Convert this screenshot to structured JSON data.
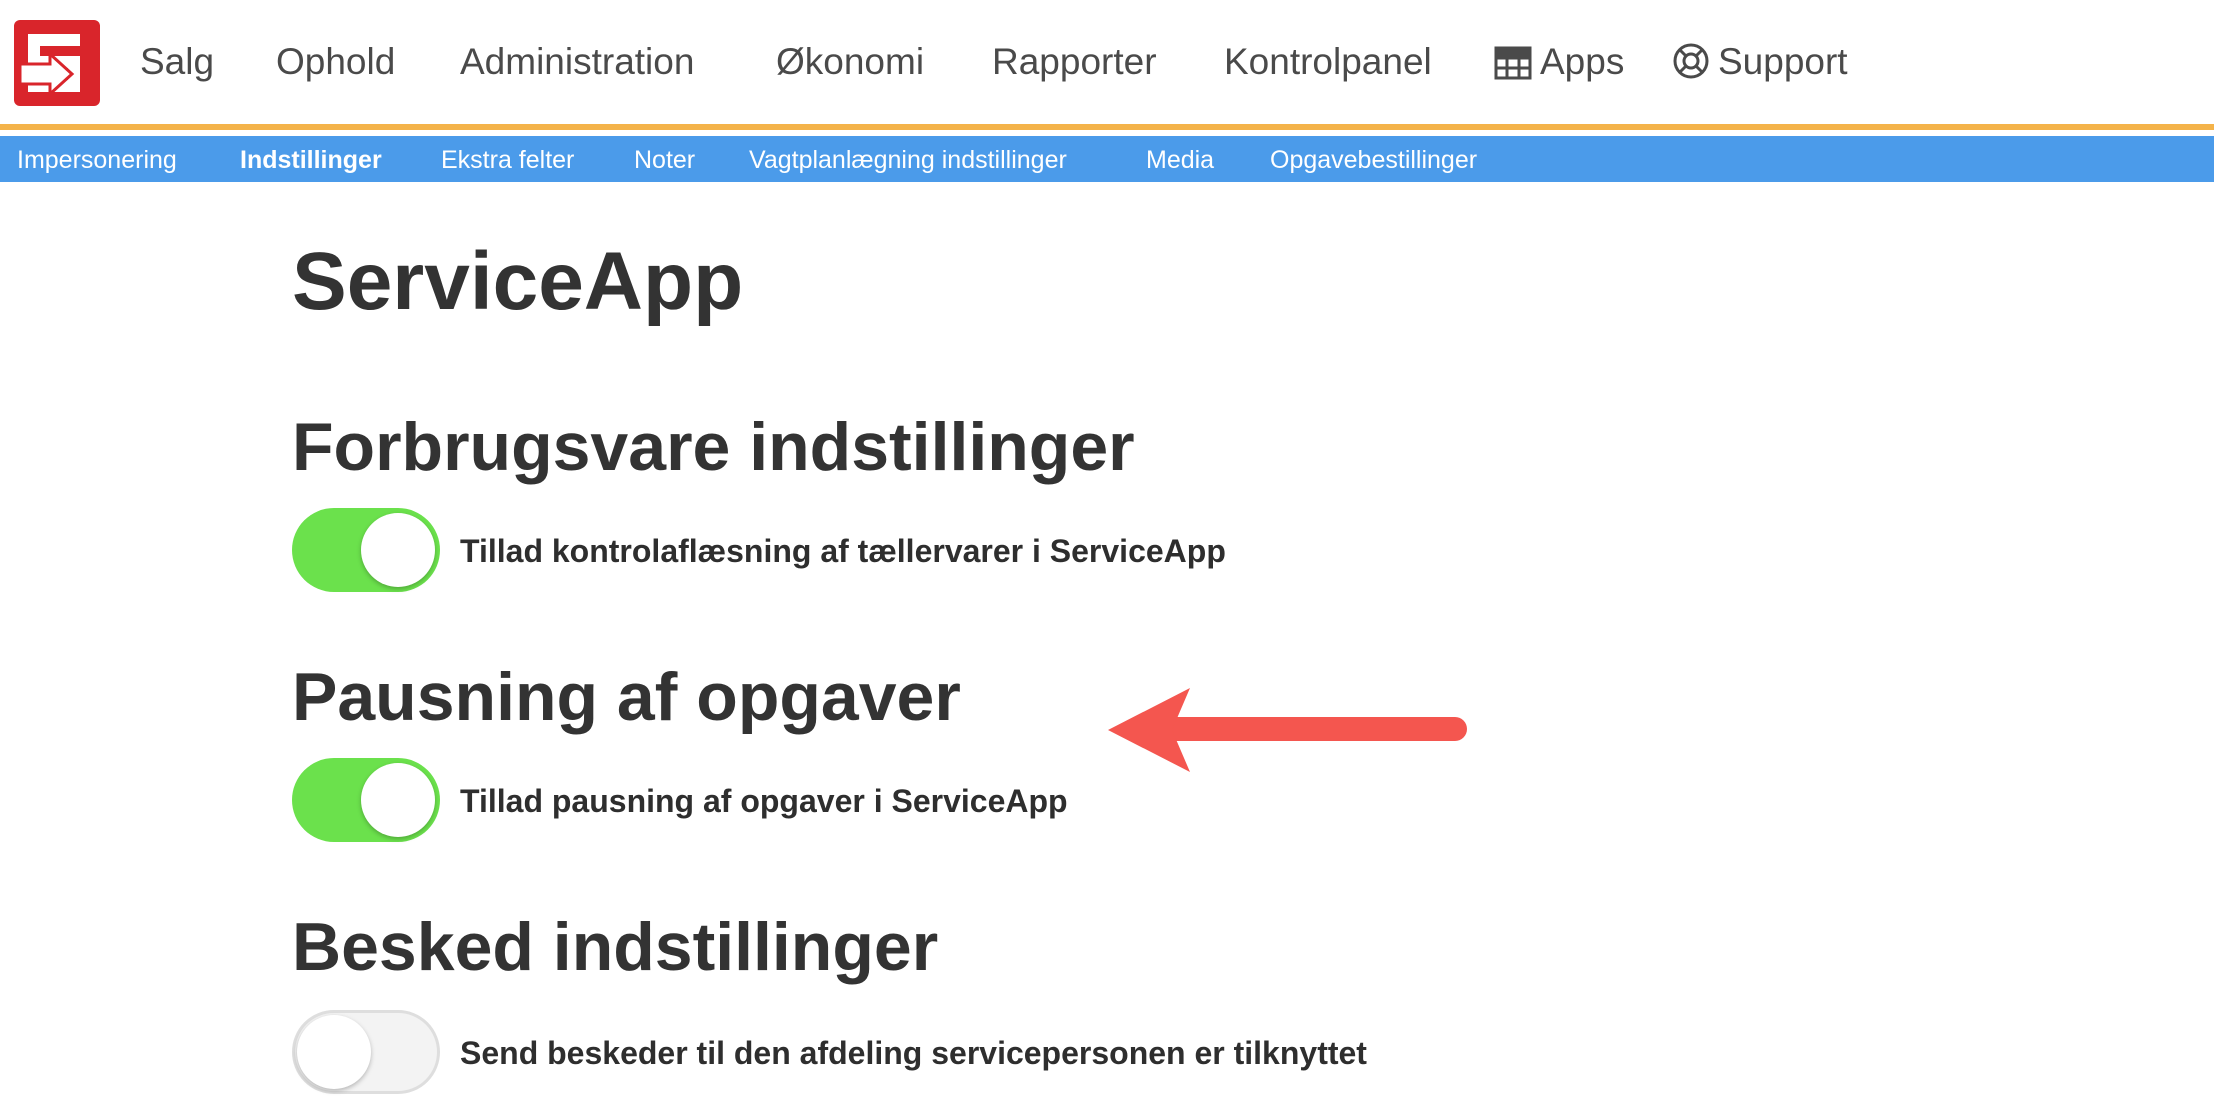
{
  "topnav": {
    "items": [
      {
        "label": "Salg"
      },
      {
        "label": "Ophold"
      },
      {
        "label": "Administration"
      },
      {
        "label": "Økonomi"
      },
      {
        "label": "Rapporter"
      },
      {
        "label": "Kontrolpanel"
      },
      {
        "label": "Apps",
        "icon": "grid-icon"
      },
      {
        "label": "Support",
        "icon": "lifebuoy-icon"
      }
    ],
    "accent_color": "#f4b34a",
    "logo_color": "#d9252b"
  },
  "subnav": {
    "color": "#4b9bea",
    "items": [
      {
        "label": "Impersonering"
      },
      {
        "label": "Indstillinger",
        "active": true
      },
      {
        "label": "Ekstra felter"
      },
      {
        "label": "Noter"
      },
      {
        "label": "Vagtplanlægning indstillinger"
      },
      {
        "label": "Media"
      },
      {
        "label": "Opgavebestillinger"
      }
    ]
  },
  "page": {
    "title": "ServiceApp",
    "sections": [
      {
        "title": "Forbrugsvare indstillinger",
        "toggle_label": "Tillad kontrolaflæsning af tællervarer i ServiceApp",
        "enabled": true
      },
      {
        "title": "Pausning af opgaver",
        "toggle_label": "Tillad pausning af opgaver i ServiceApp",
        "enabled": true
      },
      {
        "title": "Besked indstillinger",
        "toggle_label": "Send beskeder til den afdeling servicepersonen er tilknyttet",
        "enabled": false
      }
    ],
    "toggle_on_color": "#6be14c",
    "annotation_arrow_color": "#f4564f"
  }
}
